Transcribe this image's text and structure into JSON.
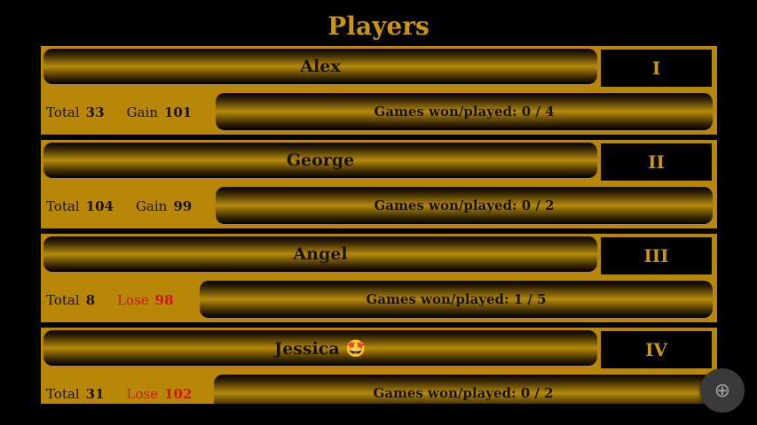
{
  "title": "Players",
  "games_label_prefix": "Games won/played: ",
  "players": [
    {
      "name": "Alex",
      "rank": "I",
      "total_label": "Total",
      "total": "33",
      "delta_label": "Gain",
      "delta": "101",
      "delta_type": "gain",
      "games": "0 / 4"
    },
    {
      "name": "George",
      "rank": "II",
      "total_label": "Total",
      "total": "104",
      "delta_label": "Gain",
      "delta": "99",
      "delta_type": "gain",
      "games": "0 / 2"
    },
    {
      "name": "Angel",
      "rank": "III",
      "total_label": "Total",
      "total": "8",
      "delta_label": "Lose",
      "delta": "98",
      "delta_type": "lose",
      "games": "1 / 5"
    },
    {
      "name": "Jessica 🤩",
      "rank": "IV",
      "total_label": "Total",
      "total": "31",
      "delta_label": "Lose",
      "delta": "102",
      "delta_type": "lose",
      "games": "0 / 2"
    }
  ],
  "fab": {
    "icon": "add-circle-icon",
    "glyph": "⊕"
  },
  "colors": {
    "accent": "#c99613",
    "card": "#b98708",
    "lose": "#d2141c",
    "background": "#000000"
  }
}
